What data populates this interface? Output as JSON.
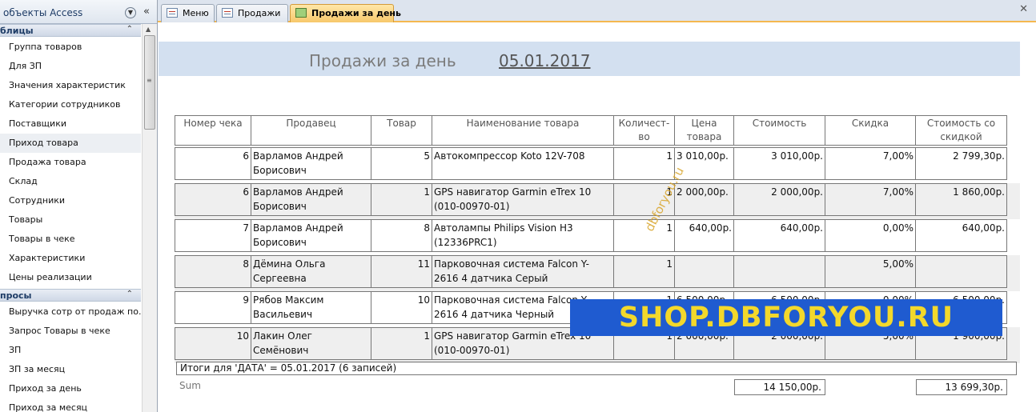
{
  "nav": {
    "title": "объекты Access",
    "groups": [
      {
        "label": "блицы",
        "items": [
          "Группа товаров",
          "Для ЗП",
          "Значения характеристик",
          "Категории сотрудников",
          "Поставщики",
          "Приход товара",
          "Продажа товара",
          "Склад",
          "Сотрудники",
          "Товары",
          "Товары в чеке",
          "Характеристики",
          "Цены реализации"
        ]
      },
      {
        "label": "просы",
        "items": [
          "Выручка сотр от продаж по...",
          "Запрос Товары в чеке",
          "ЗП",
          "ЗП за месяц",
          "Приход за день",
          "Приход за месяц"
        ]
      }
    ]
  },
  "tabs": [
    "Меню",
    "Продажи",
    "Продажи за день"
  ],
  "report": {
    "title": "Продажи за день",
    "date": "05.01.2017",
    "columns": [
      "Номер чека",
      "Продавец",
      "Товар",
      "Наименование товара",
      "Количест-во",
      "Цена товара",
      "Стоимость",
      "Скидка",
      "Стоимость со скидкой"
    ],
    "rows": [
      [
        "6",
        "Варламов Андрей Борисович",
        "5",
        "Автокомпрессор Koto 12V-708",
        "1",
        "3 010,00р.",
        "3 010,00р.",
        "7,00%",
        "2 799,30р."
      ],
      [
        "6",
        "Варламов Андрей Борисович",
        "1",
        "GPS навигатор Garmin eTrex 10 (010-00970-01)",
        "1",
        "2 000,00р.",
        "2 000,00р.",
        "7,00%",
        "1 860,00р."
      ],
      [
        "7",
        "Варламов Андрей Борисович",
        "8",
        "Автолампы Philips Vision H3 (12336PRC1)",
        "1",
        "640,00р.",
        "640,00р.",
        "0,00%",
        "640,00р."
      ],
      [
        "8",
        "Дёмина Ольга Сергеевна",
        "11",
        "Парковочная система Falcon Y-2616 4 датчика Серый",
        "1",
        "",
        "",
        "5,00%",
        ""
      ],
      [
        "9",
        "Рябов Максим Васильевич",
        "10",
        "Парковочная система Falcon Y-2616 4 датчика Черный",
        "1",
        "6 500,00р.",
        "6 500,00р.",
        "0,00%",
        "6 500,00р."
      ],
      [
        "10",
        "Лакин Олег Семёнович",
        "1",
        "GPS навигатор Garmin eTrex 10 (010-00970-01)",
        "1",
        "2 000,00р.",
        "2 000,00р.",
        "5,00%",
        "1 900,00р."
      ]
    ],
    "totals_label": "Итоги для 'ДАТА' =  05.01.2017 (6 записей)",
    "sum_label": "Sum",
    "sum_cost": "14 150,00р.",
    "sum_discounted": "13 699,30р."
  },
  "watermarks": {
    "diagonal": "dbforyou.ru",
    "banner": "SHOP.DBFORYOU.RU"
  },
  "colors": {
    "active_tab": "#f7c86b",
    "title_band": "#d3e0f0",
    "banner_bg": "#1f5bd0",
    "banner_text": "#f3d82b"
  }
}
